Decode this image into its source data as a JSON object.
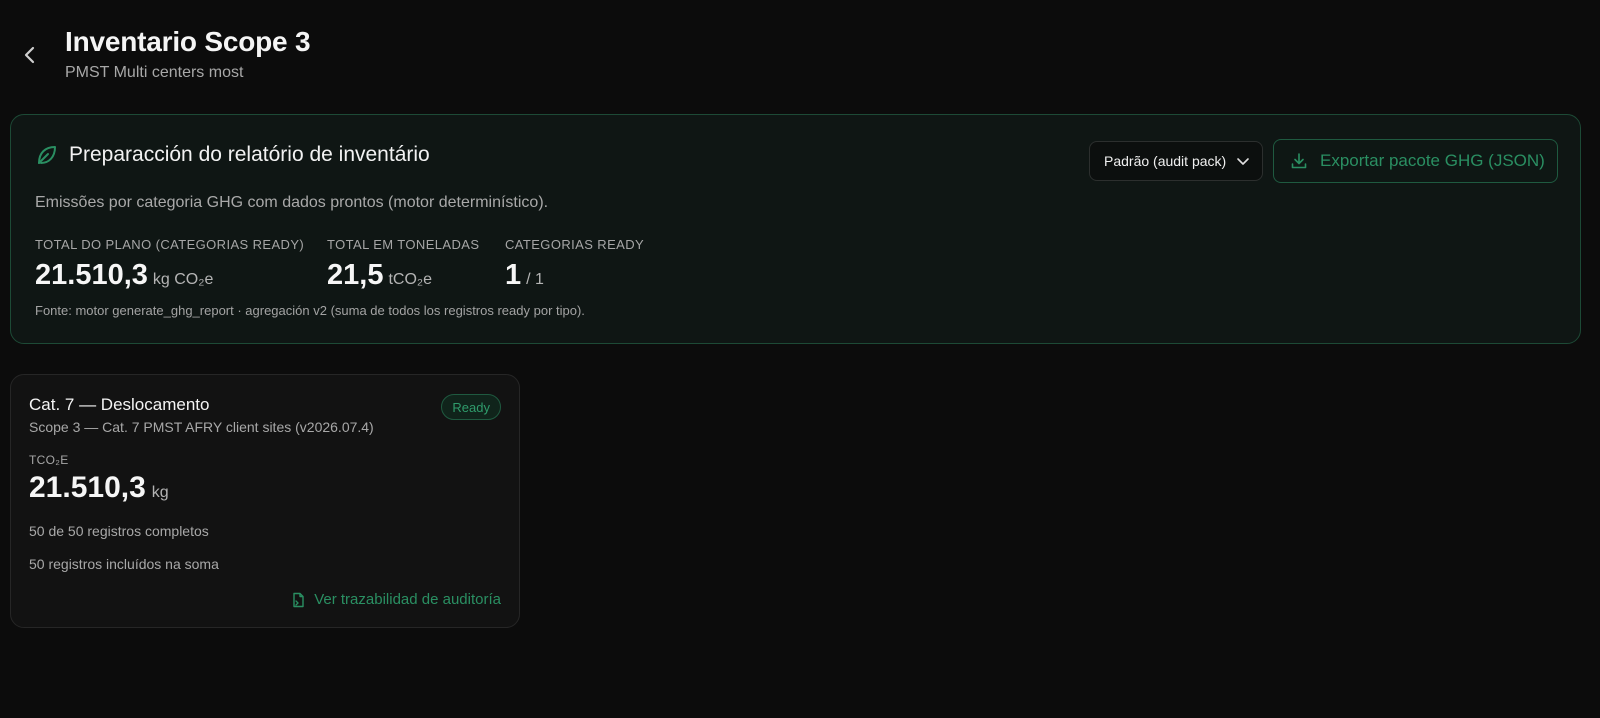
{
  "header": {
    "title": "Inventario Scope 3",
    "subtitle": "PMST Multi centers most"
  },
  "report": {
    "title": "Preparacción do relatório de inventário",
    "description": "Emissões por categoria GHG com dados prontos (motor determinístico).",
    "preset_select_value": "Padrão (audit pack)",
    "export_label": "Exportar pacote GHG (JSON)",
    "metrics": [
      {
        "label": "TOTAL DO PLANO (CATEGORIAS READY)",
        "value": "21.510,3",
        "unit": "kg CO₂e"
      },
      {
        "label": "TOTAL EM TONELADAS",
        "value": "21,5",
        "unit": "tCO₂e"
      },
      {
        "label": "CATEGORIAS READY",
        "value": "1",
        "unit": "/ 1"
      }
    ],
    "source": "Fonte: motor generate_ghg_report · agregación v2 (suma de todos los registros ready por tipo)."
  },
  "category_card": {
    "title": "Cat. 7 — Deslocamento",
    "subtitle": "Scope 3 — Cat. 7 PMST AFRY client sites (v2026.07.4)",
    "badge": "Ready",
    "metric_label": "TCO₂E",
    "value": "21.510,3",
    "unit": "kg",
    "records_complete": "50 de 50 registros completos",
    "records_included": "50 registros incluídos na soma",
    "audit_link": "Ver trazabilidad de auditoría"
  },
  "icons": {
    "back": "chevron-left-icon",
    "leaf": "leaf-icon",
    "select": "chevron-down-icon",
    "download": "download-icon",
    "document": "document-link-icon"
  },
  "colors": {
    "background": "#0c0c0c",
    "accent": "#2a8f62",
    "panel_border": "#1d4a36"
  }
}
